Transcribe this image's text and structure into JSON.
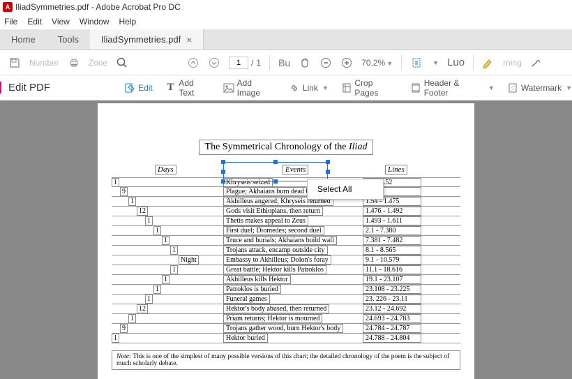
{
  "window": {
    "title": "IliadSymmetries.pdf - Adobe Acrobat Pro DC"
  },
  "menubar": [
    "File",
    "Edit",
    "View",
    "Window",
    "Help"
  ],
  "tabs": {
    "home": "Home",
    "tools": "Tools",
    "active": {
      "label": "IliadSymmetries.pdf"
    }
  },
  "toolbar": {
    "save_ghost": "Number",
    "print_ghost": "Zone",
    "page_current": "1",
    "page_total": "1",
    "bu": "Bu",
    "zoom": "70.2%",
    "luo": "Luo",
    "morning_ghost": "rning"
  },
  "editbar": {
    "title": "Edit PDF",
    "edit": "Edit",
    "addText": "Add Text",
    "addImage": "Add Image",
    "link": "Link",
    "cropPages": "Crop Pages",
    "headerFooter": "Header & Footer",
    "watermark": "Watermark"
  },
  "contextMenu": {
    "selectAll": "Select All"
  },
  "doc": {
    "title_pre": "The Symmetrical Chronology of the ",
    "title_em": "Iliad",
    "col_days": "Days",
    "col_events": "Events",
    "col_lines": "Lines",
    "rows": [
      {
        "dayIndent": 0,
        "day": "1",
        "event": "Khryseis seized",
        "lines": "1.1 - 1.52"
      },
      {
        "dayIndent": 1,
        "day": "9",
        "event": "Plague; Akhaians burn dead bodies",
        "lines": "1.53"
      },
      {
        "dayIndent": 2,
        "day": "1",
        "event": "Akhilleus angered; Khryseis returned",
        "lines": "1.54 - 1.475"
      },
      {
        "dayIndent": 3,
        "day": "12",
        "event": "Gods visit Ethiopians, then return",
        "lines": "1.476 - 1.492"
      },
      {
        "dayIndent": 4,
        "day": "1",
        "event": "Thetis makes appeal to Zeus",
        "lines": "1.493 - 1.611"
      },
      {
        "dayIndent": 5,
        "day": "1",
        "event": "First duel; Diomedes; second duel",
        "lines": "2.1 - 7.380"
      },
      {
        "dayIndent": 6,
        "day": "1",
        "event": "Truce and burials; Akhaians build wall",
        "lines": "7.381 - 7.482"
      },
      {
        "dayIndent": 7,
        "day": "1",
        "event": "Trojans attack, encamp outside city",
        "lines": "8.1 - 8.565"
      },
      {
        "dayIndent": 8,
        "day": "Night",
        "event": "Embassy to Akhilleus; Dolon's foray",
        "lines": "9.1 - 10.579"
      },
      {
        "dayIndent": 7,
        "day": "1",
        "event": "Great battle; Hektor kills Patroklos",
        "lines": "11.1 - 18.616"
      },
      {
        "dayIndent": 6,
        "day": "1",
        "event": "Akhilleus kills Hektor",
        "lines": "19.1 - 23.107"
      },
      {
        "dayIndent": 5,
        "day": "1",
        "event": "Patroklos is buried",
        "lines": "23.108 - 23.225"
      },
      {
        "dayIndent": 4,
        "day": "1",
        "event": "Funeral games",
        "lines": "23. 226 - 23.11"
      },
      {
        "dayIndent": 3,
        "day": "12",
        "event": "Hektor's body abused, then returned",
        "lines": "23.12 - 24.692"
      },
      {
        "dayIndent": 2,
        "day": "1",
        "event": "Priam returns; Hektor is mourned",
        "lines": "24.693 - 24.783"
      },
      {
        "dayIndent": 1,
        "day": "9",
        "event": "Trojans gather wood, burn Hektor's body",
        "lines": "24.784 - 24.787"
      },
      {
        "dayIndent": 0,
        "day": "1",
        "event": "Hektor buried",
        "lines": "24.788 - 24.804"
      }
    ],
    "footnote_label": "Note:",
    "footnote_text": " This is one of the simplest of many possible versions of this chart; the detailed chronology of the poem is the subject of much scholarly debate."
  }
}
